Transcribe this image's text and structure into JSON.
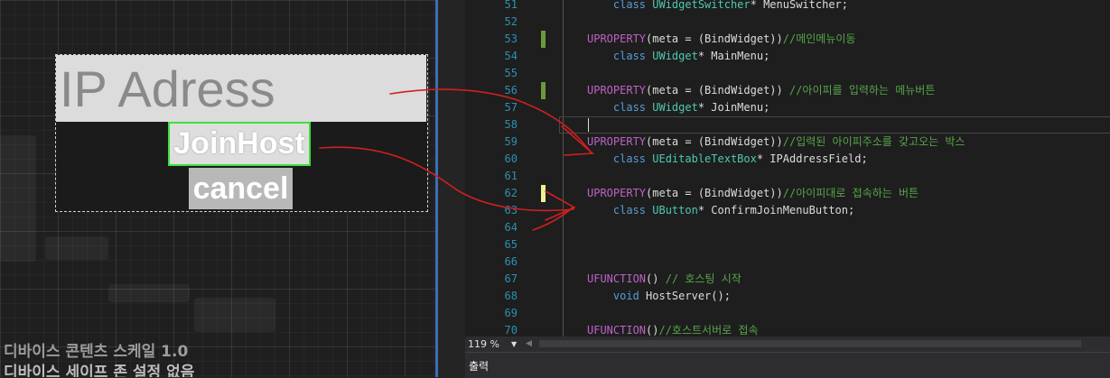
{
  "designer": {
    "ip_label": "IP Adress",
    "join_label": "JoinHost",
    "cancel_label": "cancel",
    "scale_text": "디바이스 콘텐츠 스케일 1.0",
    "status_text": "디바이스 세이프 존 설정 없음"
  },
  "editor": {
    "zoom": "119 %",
    "output_title": "출력",
    "lines": [
      {
        "n": "51",
        "parts": [
          {
            "c": "kw",
            "t": "    class "
          },
          {
            "c": "ty",
            "t": "UWidgetSwitcher"
          },
          {
            "c": "tx",
            "t": "* MenuSwitcher;"
          }
        ]
      },
      {
        "n": "52",
        "parts": []
      },
      {
        "n": "53",
        "parts": [
          {
            "c": "macro",
            "t": "UPROPERTY"
          },
          {
            "c": "tx",
            "t": "(meta = (BindWidget))"
          },
          {
            "c": "cm",
            "t": "//메인메뉴이동"
          }
        ]
      },
      {
        "n": "54",
        "parts": [
          {
            "c": "kw",
            "t": "    class "
          },
          {
            "c": "ty",
            "t": "UWidget"
          },
          {
            "c": "tx",
            "t": "* MainMenu;"
          }
        ]
      },
      {
        "n": "55",
        "parts": []
      },
      {
        "n": "56",
        "parts": [
          {
            "c": "macro",
            "t": "UPROPERTY"
          },
          {
            "c": "tx",
            "t": "(meta = (BindWidget)) "
          },
          {
            "c": "cm",
            "t": "//아이피를 입력하는 메뉴버튼"
          }
        ]
      },
      {
        "n": "57",
        "parts": [
          {
            "c": "kw",
            "t": "    class "
          },
          {
            "c": "ty",
            "t": "UWidget"
          },
          {
            "c": "tx",
            "t": "* JoinMenu;"
          }
        ]
      },
      {
        "n": "58",
        "parts": []
      },
      {
        "n": "59",
        "parts": [
          {
            "c": "macro",
            "t": "UPROPERTY"
          },
          {
            "c": "tx",
            "t": "(meta = (BindWidget))"
          },
          {
            "c": "cm",
            "t": "//입력된 아이피주소를 갖고오는 박스"
          }
        ]
      },
      {
        "n": "60",
        "parts": [
          {
            "c": "kw",
            "t": "    class "
          },
          {
            "c": "ty",
            "t": "UEditableTextBox"
          },
          {
            "c": "tx",
            "t": "* IPAddressField;"
          }
        ]
      },
      {
        "n": "61",
        "parts": []
      },
      {
        "n": "62",
        "parts": [
          {
            "c": "macro",
            "t": "UPROPERTY"
          },
          {
            "c": "tx",
            "t": "(meta = (BindWidget))"
          },
          {
            "c": "cm",
            "t": "//아이피대로 접속하는 버튼"
          }
        ]
      },
      {
        "n": "63",
        "parts": [
          {
            "c": "kw",
            "t": "    class "
          },
          {
            "c": "ty",
            "t": "UButton"
          },
          {
            "c": "tx",
            "t": "* ConfirmJoinMenuButton;"
          }
        ]
      },
      {
        "n": "64",
        "parts": []
      },
      {
        "n": "65",
        "parts": []
      },
      {
        "n": "66",
        "parts": []
      },
      {
        "n": "67",
        "parts": [
          {
            "c": "macro",
            "t": "UFUNCTION"
          },
          {
            "c": "tx",
            "t": "() "
          },
          {
            "c": "cm",
            "t": "// 호스팅 시작"
          }
        ]
      },
      {
        "n": "68",
        "parts": [
          {
            "c": "kw",
            "t": "    void "
          },
          {
            "c": "tx",
            "t": "HostServer();"
          }
        ]
      },
      {
        "n": "69",
        "parts": []
      },
      {
        "n": "70",
        "parts": [
          {
            "c": "macro",
            "t": "UFUNCTION"
          },
          {
            "c": "tx",
            "t": "()"
          },
          {
            "c": "cm",
            "t": "//호스트서버로 접속"
          }
        ]
      }
    ],
    "change_marks": [
      {
        "line": "53",
        "state": "saved",
        "color": "#6a9a3a"
      },
      {
        "line": "56",
        "state": "saved",
        "color": "#6a9a3a"
      },
      {
        "line": "62",
        "state": "unsaved",
        "color": "#efef91"
      }
    ]
  },
  "colors": {
    "join_border": "#3fe03f",
    "arrow": "#d21f1f",
    "splitter": "#3d6fb8"
  }
}
